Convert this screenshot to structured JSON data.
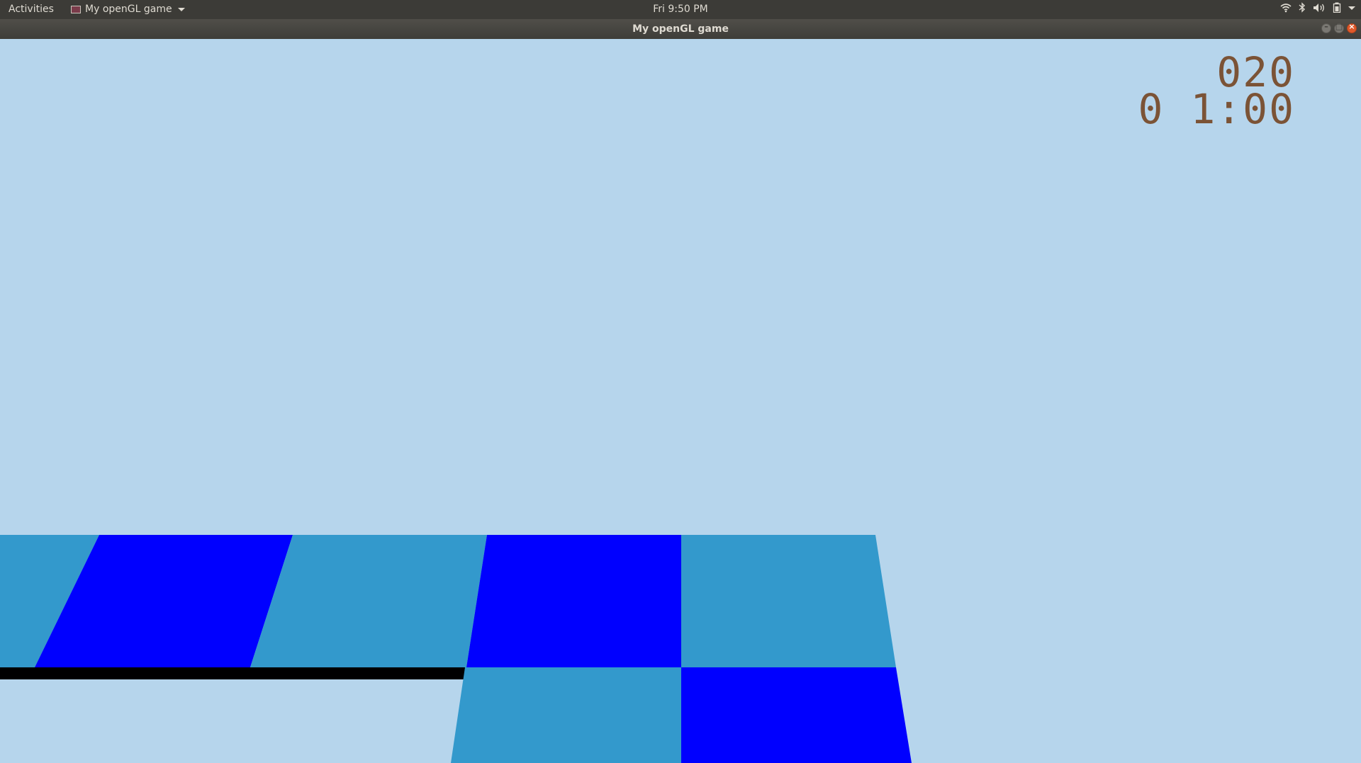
{
  "topbar": {
    "activities": "Activities",
    "app_menu_label": "My openGL game",
    "clock": "Fri  9:50 PM",
    "tray_icons": [
      "wifi-icon",
      "bluetooth-icon",
      "volume-icon",
      "battery-icon",
      "system-menu-arrow-icon"
    ]
  },
  "window": {
    "title": "My openGL game",
    "buttons": [
      "minimize",
      "maximize",
      "close"
    ]
  },
  "game": {
    "hud": {
      "score": "020",
      "timer": "0 1:00"
    },
    "colors": {
      "sky": "#b6d5ec",
      "tile_light": "#3399cc",
      "tile_dark": "#0000ff",
      "edge": "#000000",
      "hud_text": "#7b5336"
    }
  }
}
